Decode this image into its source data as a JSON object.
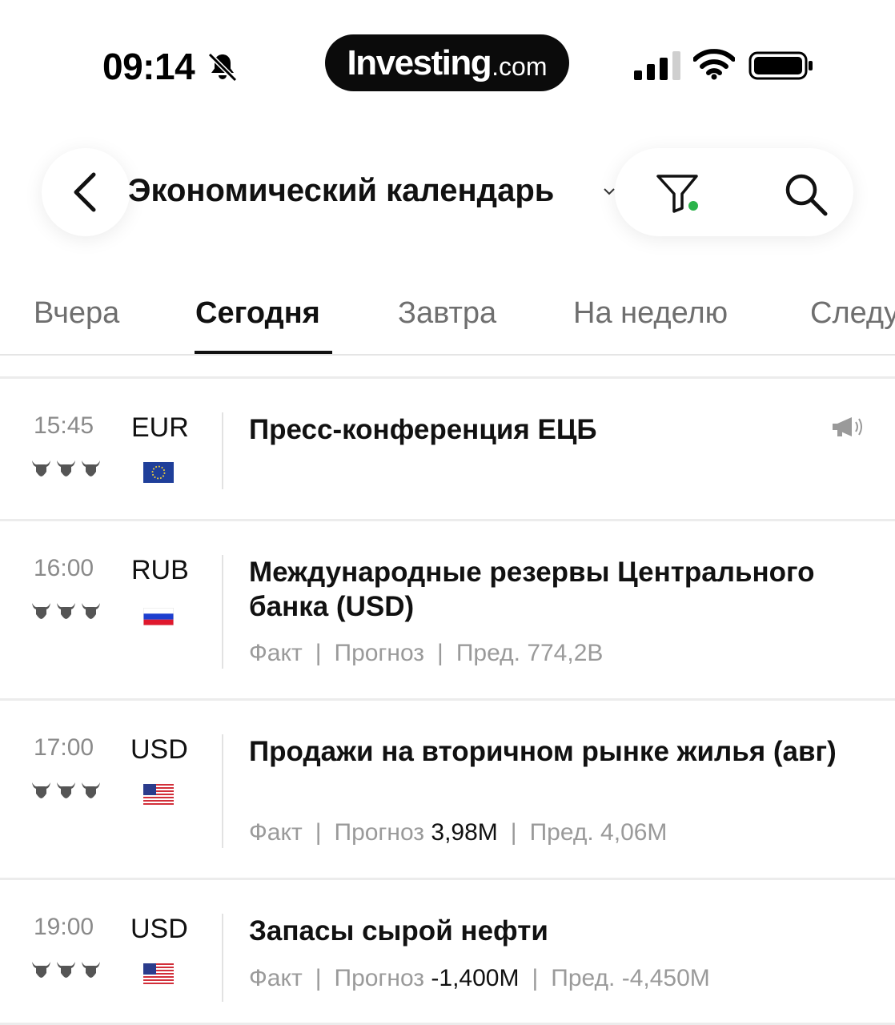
{
  "status_bar": {
    "time": "09:14",
    "icons": [
      "bell-slash-icon",
      "signal-icon",
      "wifi-icon",
      "battery-icon"
    ]
  },
  "brand": {
    "name": "Investing",
    "suffix": ".com"
  },
  "header": {
    "title": "Экономический календарь",
    "icons": [
      "back-chevron-icon",
      "filter-icon",
      "search-icon"
    ],
    "filter_active_color": "#2bb34a"
  },
  "tabs": [
    {
      "label": "Вчера",
      "active": false
    },
    {
      "label": "Сегодня",
      "active": true
    },
    {
      "label": "Завтра",
      "active": false
    },
    {
      "label": "На неделю",
      "active": false
    },
    {
      "label": "Следу",
      "active": false
    }
  ],
  "events": [
    {
      "time": "15:45",
      "currency": "EUR",
      "flag": "eu-flag-icon",
      "importance": 3,
      "title": "Пресс-конференция ЕЦБ",
      "speech": true
    },
    {
      "time": "16:00",
      "currency": "RUB",
      "flag": "ru-flag-icon",
      "importance": 3,
      "title": "Международные резервы Центрального банка (USD)",
      "fact_label": "Факт",
      "forecast_label": "Прогноз",
      "forecast": "",
      "prev_label": "Пред.",
      "prev": "774,2B"
    },
    {
      "time": "17:00",
      "currency": "USD",
      "flag": "us-flag-icon",
      "importance": 3,
      "title": "Продажи на вторичном рынке жилья (авг)",
      "fact_label": "Факт",
      "forecast_label": "Прогноз",
      "forecast": "3,98M",
      "prev_label": "Пред.",
      "prev": "4,06M"
    },
    {
      "time": "19:00",
      "currency": "USD",
      "flag": "us-flag-icon",
      "importance": 3,
      "title": "Запасы сырой нефти",
      "fact_label": "Факт",
      "forecast_label": "Прогноз",
      "forecast": "-1,400M",
      "prev_label": "Пред.",
      "prev": "-4,450M"
    }
  ]
}
